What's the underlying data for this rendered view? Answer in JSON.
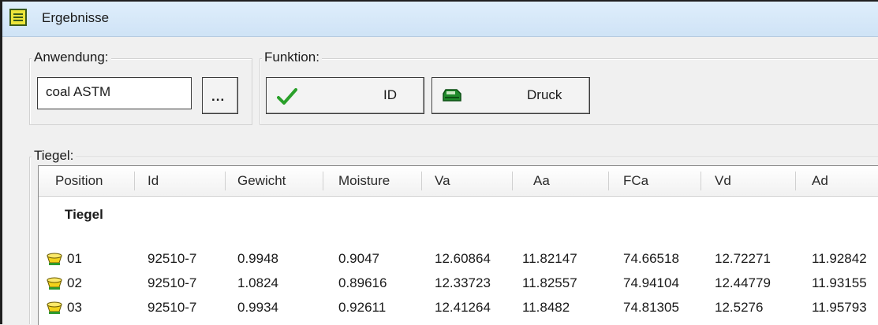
{
  "window": {
    "title": "Ergebnisse",
    "icon": "results-list-icon"
  },
  "anwendung": {
    "legend": "Anwendung:",
    "value": "coal ASTM",
    "browse_label": "..."
  },
  "funktion": {
    "legend": "Funktion:",
    "id_button": {
      "label": "ID",
      "icon": "checkmark-icon",
      "icon_color": "#2aa02a"
    },
    "druck_button": {
      "label": "Druck",
      "icon": "printer-icon",
      "icon_color": "#1f8a2a"
    }
  },
  "tiegel": {
    "legend": "Tiegel:",
    "columns": [
      "Position",
      "Id",
      "Gewicht",
      "Moisture",
      "Va",
      "Aa",
      "FCa",
      "Vd",
      "Ad"
    ],
    "group_label": "Tiegel",
    "rows": [
      {
        "position": "01",
        "id": "92510-7",
        "gewicht": "0.9948",
        "moisture": "0.9047",
        "va": "12.60864",
        "aa": "11.82147",
        "fca": "74.66518",
        "vd": "12.72271",
        "ad": "11.92842"
      },
      {
        "position": "02",
        "id": "92510-7",
        "gewicht": "1.0824",
        "moisture": "0.89616",
        "va": "12.33723",
        "aa": "11.82557",
        "fca": "74.94104",
        "vd": "12.44779",
        "ad": "11.93155"
      },
      {
        "position": "03",
        "id": "92510-7",
        "gewicht": "0.9934",
        "moisture": "0.92611",
        "va": "12.41264",
        "aa": "11.8482",
        "fca": "74.81305",
        "vd": "12.5276",
        "ad": "11.95793"
      }
    ]
  },
  "colors": {
    "crucible_icon": "#f2d21a",
    "crucible_base": "#2e9a2e"
  }
}
